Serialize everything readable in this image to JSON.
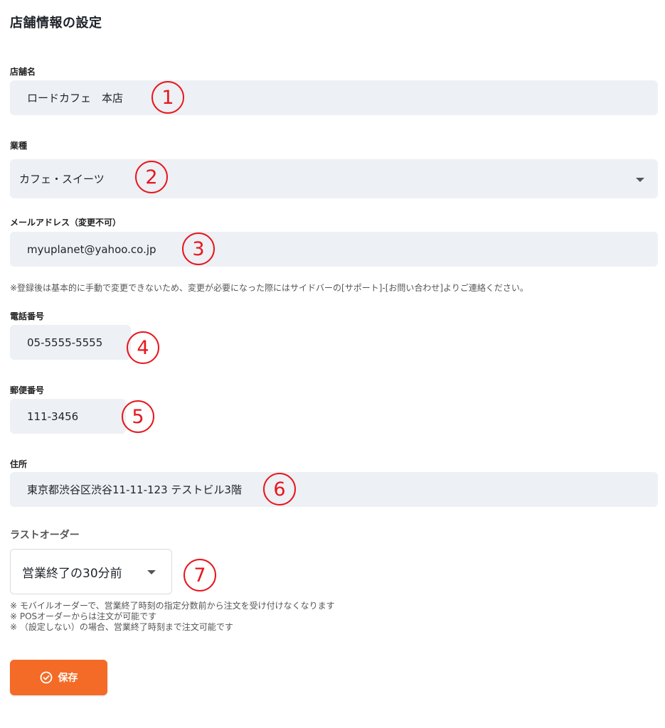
{
  "page": {
    "title": "店舗情報の設定"
  },
  "store_name": {
    "label": "店舗名",
    "value": "ロードカフェ　本店"
  },
  "business_type": {
    "label": "業種",
    "value": "カフェ・スイーツ"
  },
  "email": {
    "label": "メールアドレス（変更不可）",
    "value": "myuplanet@yahoo.co.jp",
    "note": "※登録後は基本的に手動で変更できないため、変更が必要になった際にはサイドバーの[サポート]-[お問い合わせ]よりご連絡ください。"
  },
  "phone": {
    "label": "電話番号",
    "value": "05-5555-5555"
  },
  "postal": {
    "label": "郵便番号",
    "value": "111-3456"
  },
  "address": {
    "label": "住所",
    "value": "東京都渋谷区渋谷11-11-123 テストビル3階"
  },
  "last_order": {
    "label": "ラストオーダー",
    "value": "営業終了の30分前",
    "notes": [
      "※ モバイルオーダーで、営業終了時刻の指定分数前から注文を受け付けなくなります",
      "※ POSオーダーからは注文が可能です",
      "※ （設定しない）の場合、営業終了時刻まで注文可能です"
    ]
  },
  "markers": [
    "1",
    "2",
    "3",
    "4",
    "5",
    "6",
    "7"
  ],
  "actions": {
    "save_label": "保存",
    "save_icon": "check-circle-icon"
  },
  "colors": {
    "accent": "#f36b26",
    "marker": "#e8161c",
    "field_bg": "#edf0f4"
  }
}
